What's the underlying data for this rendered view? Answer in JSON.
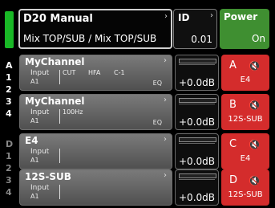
{
  "header": {
    "device_title": "D20 Manual",
    "device_subtitle": "Mix TOP/SUB / Mix TOP/SUB",
    "id_label": "ID",
    "id_value": "0.01",
    "power_label": "Power",
    "power_value": "On"
  },
  "groups": [
    {
      "letter": "A",
      "nums": [
        "1",
        "2",
        "3",
        "4"
      ]
    },
    {
      "letter": "D",
      "nums": [
        "1",
        "2",
        "3",
        "4"
      ]
    }
  ],
  "channels": [
    {
      "name": "MyChannel",
      "input": "Input",
      "input_sub": "A1",
      "procs": [
        "CUT",
        "HFA",
        "C-1"
      ],
      "eq": "EQ",
      "gain": "+0.0dB",
      "mute_channel": "A",
      "mute_signal": "E4"
    },
    {
      "name": "MyChannel",
      "input": "Input",
      "input_sub": "A1",
      "procs": [
        "100Hz"
      ],
      "eq": "EQ",
      "gain": "+0.0dB",
      "mute_channel": "B",
      "mute_signal": "12S-SUB"
    },
    {
      "name": "E4",
      "input": "Input",
      "input_sub": "A1",
      "procs": [],
      "eq": "",
      "gain": "+0.0dB",
      "mute_channel": "C",
      "mute_signal": "E4"
    },
    {
      "name": "12S-SUB",
      "input": "Input",
      "input_sub": "A1",
      "procs": [],
      "eq": "",
      "gain": "+0.0dB",
      "mute_channel": "D",
      "mute_signal": "12S-SUB"
    }
  ],
  "icons": {
    "chevron": "chevron-right-icon",
    "mute": "speaker-mute-icon"
  }
}
